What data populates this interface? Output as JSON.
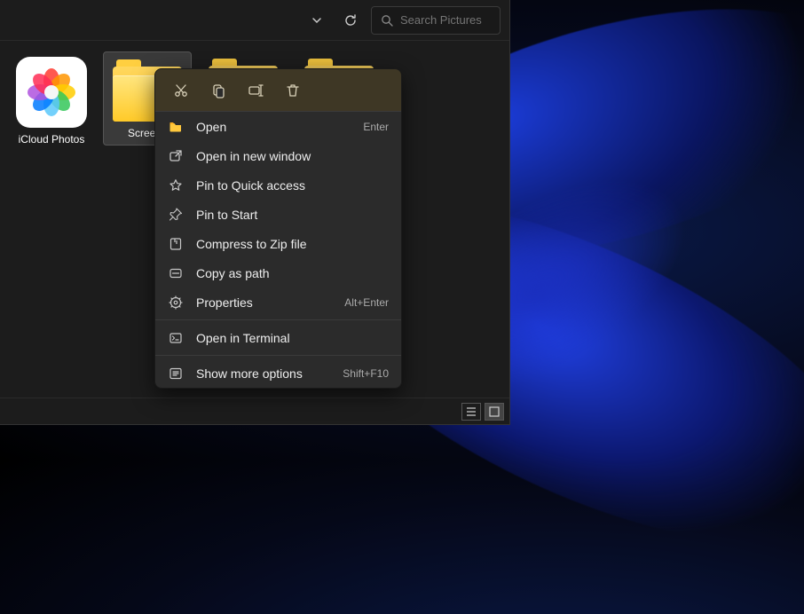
{
  "toolbar": {
    "search_placeholder": "Search Pictures"
  },
  "items": [
    {
      "name": "iCloud Photos"
    },
    {
      "name": "Screens"
    }
  ],
  "context_menu": {
    "open": {
      "label": "Open",
      "accel": "Enter"
    },
    "open_new_window": {
      "label": "Open in new window"
    },
    "pin_quick": {
      "label": "Pin to Quick access"
    },
    "pin_start": {
      "label": "Pin to Start"
    },
    "compress": {
      "label": "Compress to Zip file"
    },
    "copy_path": {
      "label": "Copy as path"
    },
    "properties": {
      "label": "Properties",
      "accel": "Alt+Enter"
    },
    "terminal": {
      "label": "Open in Terminal"
    },
    "more": {
      "label": "Show more options",
      "accel": "Shift+F10"
    }
  }
}
